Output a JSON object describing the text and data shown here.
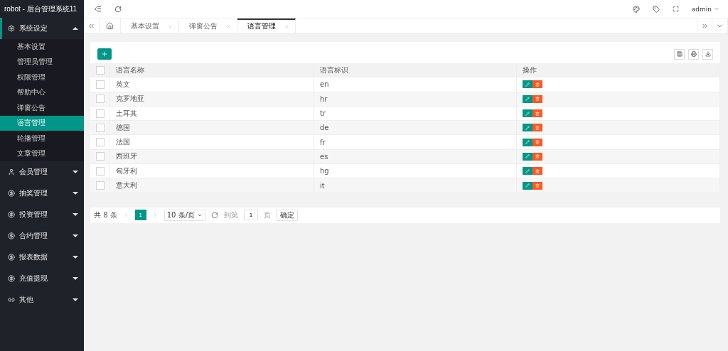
{
  "brand": "robot - 后台管理系统11",
  "sidebar": {
    "groups": [
      {
        "label": "系统设定",
        "expanded": true,
        "children": [
          {
            "label": "基本设置",
            "selected": false
          },
          {
            "label": "管理员管理",
            "selected": false
          },
          {
            "label": "权限管理",
            "selected": false
          },
          {
            "label": "帮助中心",
            "selected": false
          },
          {
            "label": "弹窗公告",
            "selected": false
          },
          {
            "label": "语言管理",
            "selected": true
          },
          {
            "label": "轮播管理",
            "selected": false
          },
          {
            "label": "文章管理",
            "selected": false
          }
        ]
      },
      {
        "label": "会员管理",
        "expanded": false
      },
      {
        "label": "抽奖管理",
        "expanded": false
      },
      {
        "label": "投资管理",
        "expanded": false
      },
      {
        "label": "合约管理",
        "expanded": false
      },
      {
        "label": "报表数据",
        "expanded": false
      },
      {
        "label": "充值提现",
        "expanded": false
      },
      {
        "label": "其他",
        "expanded": false
      }
    ]
  },
  "header": {
    "user": "admin"
  },
  "tabs": [
    {
      "label": "基本设置",
      "selected": false
    },
    {
      "label": "弹窗公告",
      "selected": false
    },
    {
      "label": "语言管理",
      "selected": true
    }
  ],
  "table": {
    "select_all_checked": false,
    "columns": [
      "语言名称",
      "语言标识",
      "操作"
    ],
    "rows": [
      {
        "name": "英文",
        "code": "en",
        "checked": false
      },
      {
        "name": "克罗地亚",
        "code": "hr",
        "checked": false
      },
      {
        "name": "土耳其",
        "code": "tr",
        "checked": false
      },
      {
        "name": "德国",
        "code": "de",
        "checked": false
      },
      {
        "name": "法国",
        "code": "fr",
        "checked": false
      },
      {
        "name": "西班牙",
        "code": "es",
        "checked": false
      },
      {
        "name": "匈牙利",
        "code": "hg",
        "checked": false
      },
      {
        "name": "意大利",
        "code": "it",
        "checked": false
      }
    ]
  },
  "pagination": {
    "total": "共 8 条",
    "pages": [
      {
        "label": "1",
        "selected": true
      }
    ],
    "page_size": "10 条/页",
    "goto_label": "到第",
    "goto_value": "1",
    "page_unit": "页",
    "confirm": "确定"
  }
}
